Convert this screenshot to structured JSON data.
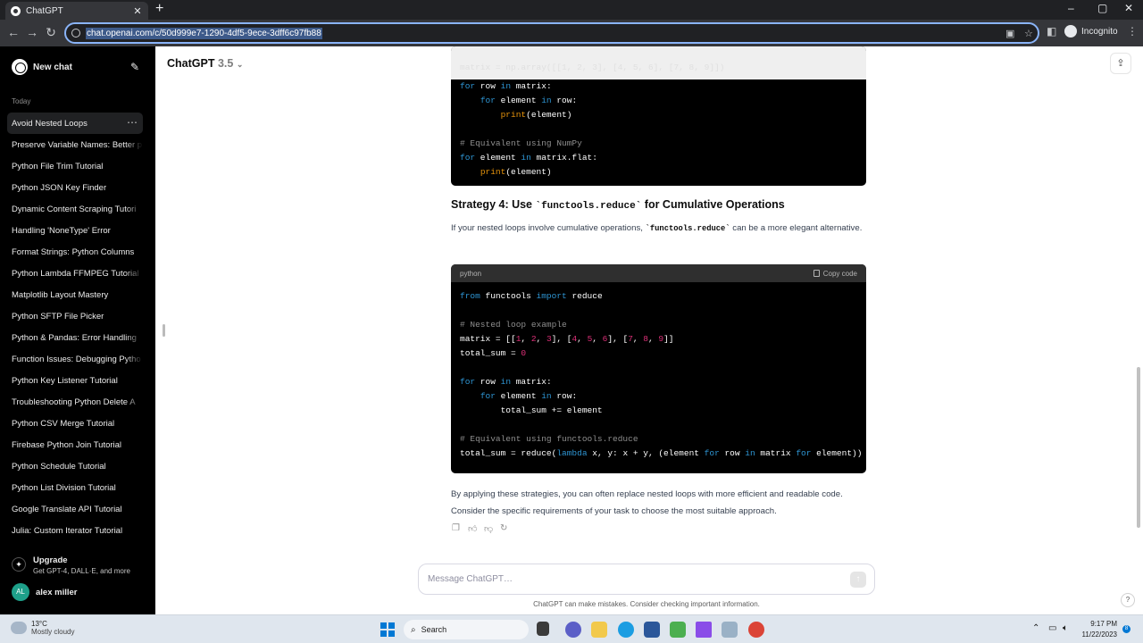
{
  "browser": {
    "tab_title": "ChatGPT",
    "tab_close": "✕",
    "new_tab": "+",
    "url": "chat.openai.com/c/50d999e7-1290-4df5-9ece-3dff6c97fb88",
    "incognito_label": "Incognito",
    "window_controls": [
      "–",
      "▢",
      "✕"
    ]
  },
  "sidebar": {
    "new_chat_label": "New chat",
    "section_label": "Today",
    "items": [
      {
        "label": "Avoid Nested Loops"
      },
      {
        "label": "Preserve Variable Names: Better p"
      },
      {
        "label": "Python File Trim Tutorial"
      },
      {
        "label": "Python JSON Key Finder"
      },
      {
        "label": "Dynamic Content Scraping Tutori"
      },
      {
        "label": "Handling 'NoneType' Error"
      },
      {
        "label": "Format Strings: Python Columns"
      },
      {
        "label": "Python Lambda FFMPEG Tutorial"
      },
      {
        "label": "Matplotlib Layout Mastery"
      },
      {
        "label": "Python SFTP File Picker"
      },
      {
        "label": "Python & Pandas: Error Handling"
      },
      {
        "label": "Function Issues: Debugging Pytho"
      },
      {
        "label": "Python Key Listener Tutorial"
      },
      {
        "label": "Troubleshooting Python Delete A"
      },
      {
        "label": "Python CSV Merge Tutorial"
      },
      {
        "label": "Firebase Python Join Tutorial"
      },
      {
        "label": "Python Schedule Tutorial"
      },
      {
        "label": "Python List Division Tutorial"
      },
      {
        "label": "Google Translate API Tutorial"
      },
      {
        "label": "Julia: Custom Iterator Tutorial"
      }
    ],
    "upgrade_title": "Upgrade",
    "upgrade_subtitle": "Get GPT-4, DALL·E, and more",
    "user_initials": "AL",
    "user_name": "alex miller"
  },
  "main": {
    "model_name": "ChatGPT",
    "model_version": "3.5",
    "heading_prefix": "Strategy 4: Use ",
    "heading_code": "`functools.reduce`",
    "heading_suffix": " for Cumulative Operations",
    "para1_prefix": "If your nested loops involve cumulative operations, ",
    "para1_code": "`functools.reduce`",
    "para1_suffix": " can be a more elegant alternative.",
    "code_lang": "python",
    "copy_label": "Copy code",
    "para2": "By applying these strategies, you can often replace nested loops with more efficient and readable code. Consider the specific requirements of your task to choose the most suitable approach.",
    "input_placeholder": "Message ChatGPT…",
    "disclaimer": "ChatGPT can make mistakes. Consider checking important information.",
    "help": "?"
  },
  "taskbar": {
    "temperature": "13°C",
    "condition": "Mostly cloudy",
    "search_label": "Search",
    "time": "9:17 PM",
    "date": "11/22/2023",
    "notification_count": "8"
  }
}
